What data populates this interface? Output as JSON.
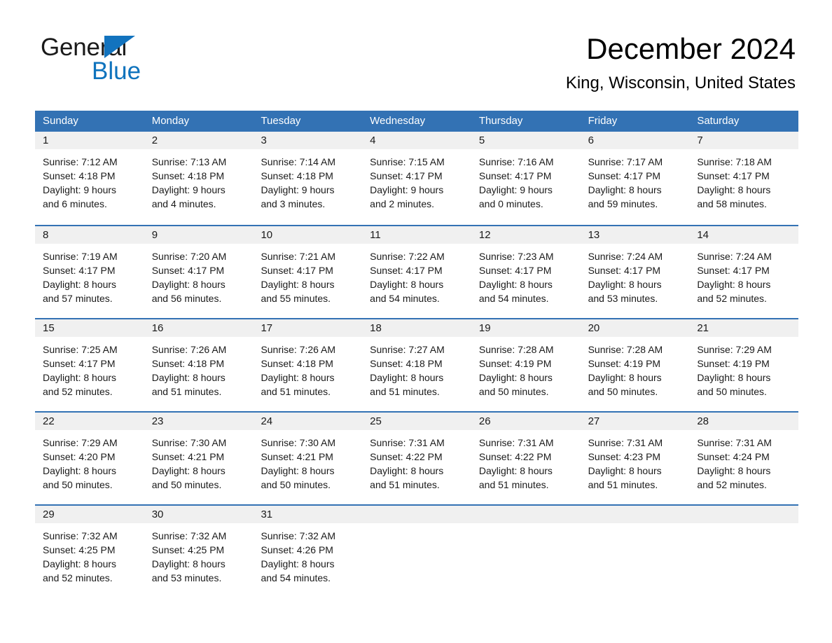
{
  "brand": {
    "name_part1": "General",
    "name_part2": "Blue",
    "triangle_icon": "triangle-icon",
    "accent_color": "#1273BE"
  },
  "header": {
    "month_title": "December 2024",
    "location": "King, Wisconsin, United States"
  },
  "colors": {
    "header_blue": "#3372B4",
    "daynum_strip": "#F0F0F0",
    "text": "#1a1a1a",
    "brand_blue": "#0F73BD"
  },
  "weekdays": [
    "Sunday",
    "Monday",
    "Tuesday",
    "Wednesday",
    "Thursday",
    "Friday",
    "Saturday"
  ],
  "weeks": [
    [
      {
        "day": "1",
        "sunrise": "Sunrise: 7:12 AM",
        "sunset": "Sunset: 4:18 PM",
        "daylight1": "Daylight: 9 hours",
        "daylight2": "and 6 minutes."
      },
      {
        "day": "2",
        "sunrise": "Sunrise: 7:13 AM",
        "sunset": "Sunset: 4:18 PM",
        "daylight1": "Daylight: 9 hours",
        "daylight2": "and 4 minutes."
      },
      {
        "day": "3",
        "sunrise": "Sunrise: 7:14 AM",
        "sunset": "Sunset: 4:18 PM",
        "daylight1": "Daylight: 9 hours",
        "daylight2": "and 3 minutes."
      },
      {
        "day": "4",
        "sunrise": "Sunrise: 7:15 AM",
        "sunset": "Sunset: 4:17 PM",
        "daylight1": "Daylight: 9 hours",
        "daylight2": "and 2 minutes."
      },
      {
        "day": "5",
        "sunrise": "Sunrise: 7:16 AM",
        "sunset": "Sunset: 4:17 PM",
        "daylight1": "Daylight: 9 hours",
        "daylight2": "and 0 minutes."
      },
      {
        "day": "6",
        "sunrise": "Sunrise: 7:17 AM",
        "sunset": "Sunset: 4:17 PM",
        "daylight1": "Daylight: 8 hours",
        "daylight2": "and 59 minutes."
      },
      {
        "day": "7",
        "sunrise": "Sunrise: 7:18 AM",
        "sunset": "Sunset: 4:17 PM",
        "daylight1": "Daylight: 8 hours",
        "daylight2": "and 58 minutes."
      }
    ],
    [
      {
        "day": "8",
        "sunrise": "Sunrise: 7:19 AM",
        "sunset": "Sunset: 4:17 PM",
        "daylight1": "Daylight: 8 hours",
        "daylight2": "and 57 minutes."
      },
      {
        "day": "9",
        "sunrise": "Sunrise: 7:20 AM",
        "sunset": "Sunset: 4:17 PM",
        "daylight1": "Daylight: 8 hours",
        "daylight2": "and 56 minutes."
      },
      {
        "day": "10",
        "sunrise": "Sunrise: 7:21 AM",
        "sunset": "Sunset: 4:17 PM",
        "daylight1": "Daylight: 8 hours",
        "daylight2": "and 55 minutes."
      },
      {
        "day": "11",
        "sunrise": "Sunrise: 7:22 AM",
        "sunset": "Sunset: 4:17 PM",
        "daylight1": "Daylight: 8 hours",
        "daylight2": "and 54 minutes."
      },
      {
        "day": "12",
        "sunrise": "Sunrise: 7:23 AM",
        "sunset": "Sunset: 4:17 PM",
        "daylight1": "Daylight: 8 hours",
        "daylight2": "and 54 minutes."
      },
      {
        "day": "13",
        "sunrise": "Sunrise: 7:24 AM",
        "sunset": "Sunset: 4:17 PM",
        "daylight1": "Daylight: 8 hours",
        "daylight2": "and 53 minutes."
      },
      {
        "day": "14",
        "sunrise": "Sunrise: 7:24 AM",
        "sunset": "Sunset: 4:17 PM",
        "daylight1": "Daylight: 8 hours",
        "daylight2": "and 52 minutes."
      }
    ],
    [
      {
        "day": "15",
        "sunrise": "Sunrise: 7:25 AM",
        "sunset": "Sunset: 4:17 PM",
        "daylight1": "Daylight: 8 hours",
        "daylight2": "and 52 minutes."
      },
      {
        "day": "16",
        "sunrise": "Sunrise: 7:26 AM",
        "sunset": "Sunset: 4:18 PM",
        "daylight1": "Daylight: 8 hours",
        "daylight2": "and 51 minutes."
      },
      {
        "day": "17",
        "sunrise": "Sunrise: 7:26 AM",
        "sunset": "Sunset: 4:18 PM",
        "daylight1": "Daylight: 8 hours",
        "daylight2": "and 51 minutes."
      },
      {
        "day": "18",
        "sunrise": "Sunrise: 7:27 AM",
        "sunset": "Sunset: 4:18 PM",
        "daylight1": "Daylight: 8 hours",
        "daylight2": "and 51 minutes."
      },
      {
        "day": "19",
        "sunrise": "Sunrise: 7:28 AM",
        "sunset": "Sunset: 4:19 PM",
        "daylight1": "Daylight: 8 hours",
        "daylight2": "and 50 minutes."
      },
      {
        "day": "20",
        "sunrise": "Sunrise: 7:28 AM",
        "sunset": "Sunset: 4:19 PM",
        "daylight1": "Daylight: 8 hours",
        "daylight2": "and 50 minutes."
      },
      {
        "day": "21",
        "sunrise": "Sunrise: 7:29 AM",
        "sunset": "Sunset: 4:19 PM",
        "daylight1": "Daylight: 8 hours",
        "daylight2": "and 50 minutes."
      }
    ],
    [
      {
        "day": "22",
        "sunrise": "Sunrise: 7:29 AM",
        "sunset": "Sunset: 4:20 PM",
        "daylight1": "Daylight: 8 hours",
        "daylight2": "and 50 minutes."
      },
      {
        "day": "23",
        "sunrise": "Sunrise: 7:30 AM",
        "sunset": "Sunset: 4:21 PM",
        "daylight1": "Daylight: 8 hours",
        "daylight2": "and 50 minutes."
      },
      {
        "day": "24",
        "sunrise": "Sunrise: 7:30 AM",
        "sunset": "Sunset: 4:21 PM",
        "daylight1": "Daylight: 8 hours",
        "daylight2": "and 50 minutes."
      },
      {
        "day": "25",
        "sunrise": "Sunrise: 7:31 AM",
        "sunset": "Sunset: 4:22 PM",
        "daylight1": "Daylight: 8 hours",
        "daylight2": "and 51 minutes."
      },
      {
        "day": "26",
        "sunrise": "Sunrise: 7:31 AM",
        "sunset": "Sunset: 4:22 PM",
        "daylight1": "Daylight: 8 hours",
        "daylight2": "and 51 minutes."
      },
      {
        "day": "27",
        "sunrise": "Sunrise: 7:31 AM",
        "sunset": "Sunset: 4:23 PM",
        "daylight1": "Daylight: 8 hours",
        "daylight2": "and 51 minutes."
      },
      {
        "day": "28",
        "sunrise": "Sunrise: 7:31 AM",
        "sunset": "Sunset: 4:24 PM",
        "daylight1": "Daylight: 8 hours",
        "daylight2": "and 52 minutes."
      }
    ],
    [
      {
        "day": "29",
        "sunrise": "Sunrise: 7:32 AM",
        "sunset": "Sunset: 4:25 PM",
        "daylight1": "Daylight: 8 hours",
        "daylight2": "and 52 minutes."
      },
      {
        "day": "30",
        "sunrise": "Sunrise: 7:32 AM",
        "sunset": "Sunset: 4:25 PM",
        "daylight1": "Daylight: 8 hours",
        "daylight2": "and 53 minutes."
      },
      {
        "day": "31",
        "sunrise": "Sunrise: 7:32 AM",
        "sunset": "Sunset: 4:26 PM",
        "daylight1": "Daylight: 8 hours",
        "daylight2": "and 54 minutes."
      },
      {
        "day": "",
        "sunrise": "",
        "sunset": "",
        "daylight1": "",
        "daylight2": ""
      },
      {
        "day": "",
        "sunrise": "",
        "sunset": "",
        "daylight1": "",
        "daylight2": ""
      },
      {
        "day": "",
        "sunrise": "",
        "sunset": "",
        "daylight1": "",
        "daylight2": ""
      },
      {
        "day": "",
        "sunrise": "",
        "sunset": "",
        "daylight1": "",
        "daylight2": ""
      }
    ]
  ]
}
